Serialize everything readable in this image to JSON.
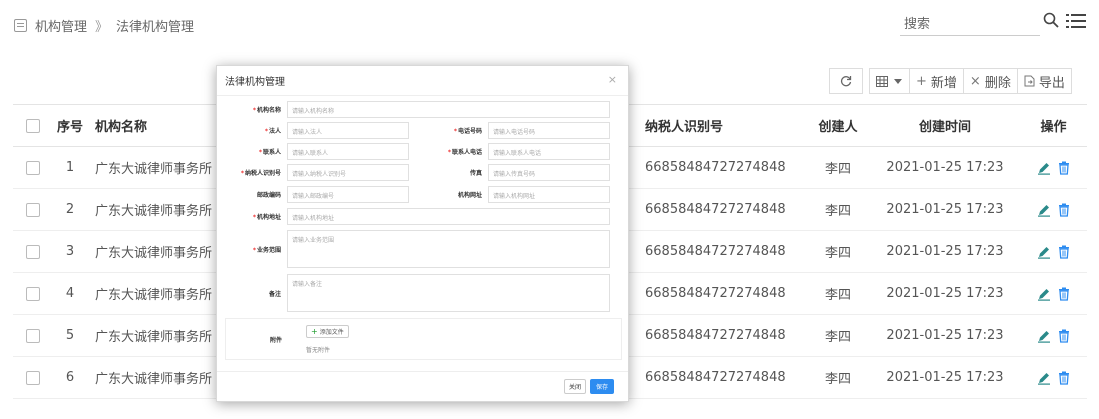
{
  "breadcrumb": {
    "parent": "机构管理",
    "separator": "》",
    "current": "法律机构管理"
  },
  "search": {
    "placeholder": "搜索"
  },
  "toolbar": {
    "refresh_icon": "refresh-icon",
    "columns_icon": "grid-icon",
    "add_label": "新增",
    "delete_label": "删除",
    "export_label": "导出"
  },
  "table": {
    "headers": {
      "index": "序号",
      "name": "机构名称",
      "tax": "纳税人识别号",
      "creator": "创建人",
      "created": "创建时间",
      "ops": "操作"
    },
    "rows": [
      {
        "index": "1",
        "name": "广东大诚律师事务所",
        "tax": "66858484727274848",
        "creator": "李四",
        "created": "2021-01-25 17:23"
      },
      {
        "index": "2",
        "name": "广东大诚律师事务所",
        "tax": "66858484727274848",
        "creator": "李四",
        "created": "2021-01-25 17:23"
      },
      {
        "index": "3",
        "name": "广东大诚律师事务所",
        "tax": "66858484727274848",
        "creator": "李四",
        "created": "2021-01-25 17:23"
      },
      {
        "index": "4",
        "name": "广东大诚律师事务所",
        "tax": "66858484727274848",
        "creator": "李四",
        "created": "2021-01-25 17:23"
      },
      {
        "index": "5",
        "name": "广东大诚律师事务所",
        "tax": "66858484727274848",
        "creator": "李四",
        "created": "2021-01-25 17:23"
      },
      {
        "index": "6",
        "name": "广东大诚律师事务所",
        "tax": "66858484727274848",
        "creator": "李四",
        "created": "2021-01-25 17:23"
      }
    ]
  },
  "modal": {
    "title": "法律机构管理",
    "close_glyph": "×",
    "fields": {
      "org_name": {
        "label": "机构名称",
        "placeholder": "请输入机构名称"
      },
      "legal": {
        "label": "法人",
        "placeholder": "请输入法人"
      },
      "phone": {
        "label": "电话号码",
        "placeholder": "请输入电话号码"
      },
      "contact": {
        "label": "联系人",
        "placeholder": "请输入联系人"
      },
      "contact_phone": {
        "label": "联系人电话",
        "placeholder": "请输入联系人电话"
      },
      "tax_id": {
        "label": "纳税人识别号",
        "placeholder": "请输入纳税人识别号"
      },
      "fax": {
        "label": "传真",
        "placeholder": "请输入传真号码"
      },
      "postcode": {
        "label": "邮政编码",
        "placeholder": "请输入邮政编号"
      },
      "website": {
        "label": "机构网址",
        "placeholder": "请输入机构网址"
      },
      "address": {
        "label": "机构地址",
        "placeholder": "请输入机构地址"
      },
      "scope": {
        "label": "业务范围",
        "placeholder": "请输入业务范围"
      },
      "remark": {
        "label": "备注",
        "placeholder": "请输入备注"
      },
      "attachment": {
        "label": "附件",
        "add_label": "添加文件",
        "empty_text": "暂无附件"
      }
    },
    "close_label": "关闭",
    "save_label": "保存"
  },
  "colors": {
    "primary": "#2d8cf0",
    "required": "#e33333",
    "edit": "#2a8a8a",
    "delete": "#2d8cf0"
  }
}
